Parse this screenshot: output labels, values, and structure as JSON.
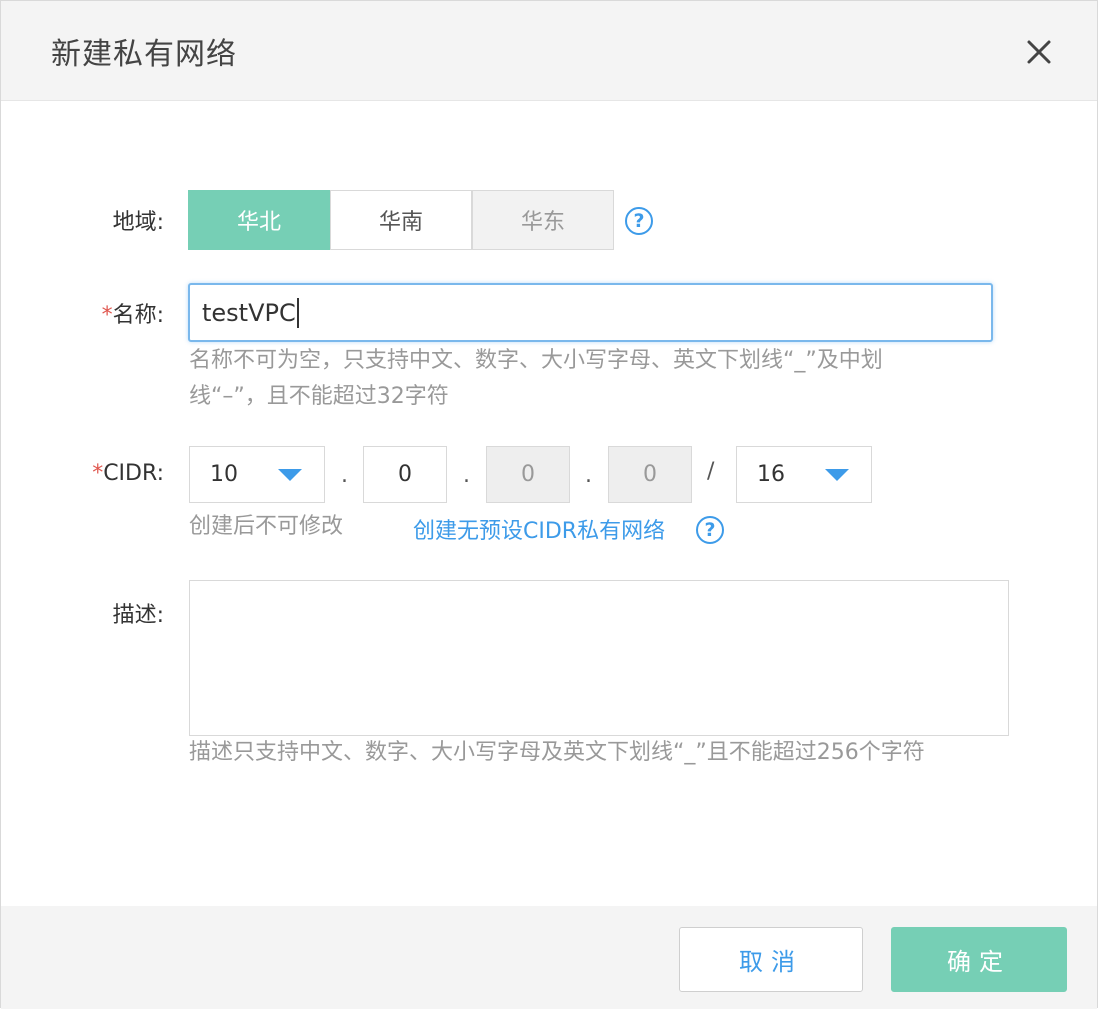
{
  "dialog": {
    "title": "新建私有网络"
  },
  "region": {
    "label": "地域:",
    "options": [
      "华北",
      "华南",
      "华东"
    ],
    "selected": "华北"
  },
  "name": {
    "required_mark": "*",
    "label": "名称:",
    "value": "testVPC",
    "hint_line1": "名称不可为空，只支持中文、数字、大小写字母、英文下划线“_”及中划",
    "hint_line2": "线“–”，且不能超过32字符"
  },
  "cidr": {
    "required_mark": "*",
    "label": "CIDR:",
    "octet1": "10",
    "octet2": "0",
    "octet3": "0",
    "octet4": "0",
    "dot": ".",
    "slash": "/",
    "mask": "16",
    "hint": "创建后不可修改",
    "link": "创建无预设CIDR私有网络"
  },
  "description": {
    "label": "描述:",
    "value": "",
    "hint": "描述只支持中文、数字、大小写字母及英文下划线“_”且不能超过256个字符"
  },
  "help_glyph": "?",
  "footer": {
    "cancel_label": "取消",
    "ok_label": "确定"
  },
  "colors": {
    "accent_green": "#76cfb5",
    "link_blue": "#3d9be9",
    "required_red": "#e0574f"
  },
  "icons": [
    "close-icon",
    "help-icon",
    "dropdown-arrow-icon"
  ]
}
